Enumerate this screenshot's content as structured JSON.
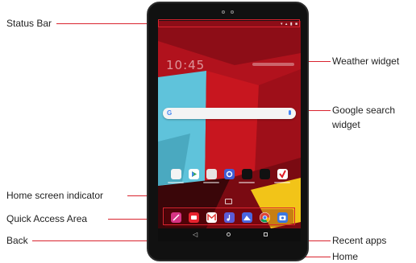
{
  "callouts": {
    "status_bar": "Status Bar",
    "home_screen_indicator": "Home screen indicator",
    "quick_access_area": "Quick Access Area",
    "back": "Back",
    "weather_widget": "Weather widget",
    "google_search_widget_line1": "Google search",
    "google_search_widget_line2": "widget",
    "recent_apps": "Recent apps",
    "home": "Home"
  },
  "screen": {
    "clock": "10:45",
    "search_logo": "G",
    "status_icons": "▾ ▴ ▮ ■"
  },
  "colors": {
    "accent_line": "#d9232e",
    "wallpaper_red": "#b1121d",
    "wallpaper_dark": "#5a0a10",
    "wallpaper_cyan": "#5fc3db",
    "wallpaper_yellow": "#f2c418"
  },
  "apps_row": [
    "apps-icon",
    "play-store-icon",
    "gallery-icon",
    "settings-icon",
    "cloud-icon",
    "safe-icon",
    "verizon-icon"
  ],
  "quick_access": [
    "pen-icon",
    "messages-icon",
    "gmail-icon",
    "music-icon",
    "photos-icon",
    "chrome-icon",
    "camera-icon"
  ]
}
